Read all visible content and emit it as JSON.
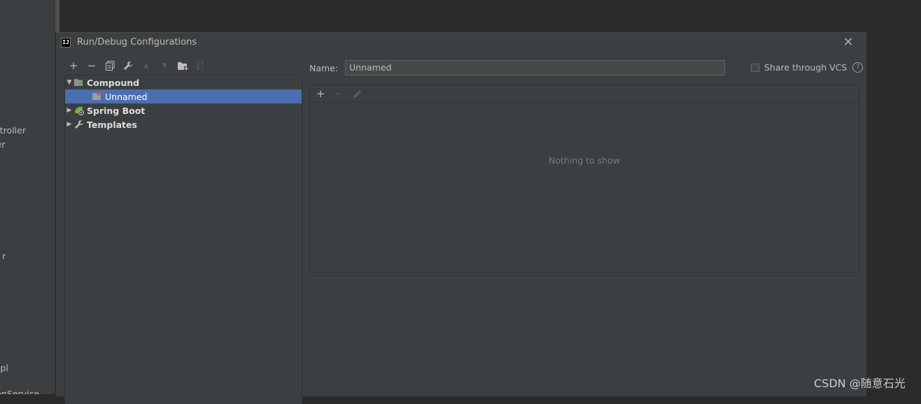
{
  "background_panel": {
    "fragments": [
      "onController",
      "ller",
      "r",
      "er",
      "mpl",
      "ationService"
    ]
  },
  "dialog": {
    "app_icon_text": "IJ",
    "title": "Run/Debug Configurations",
    "close_glyph": "✕"
  },
  "toolbar": {
    "items": [
      {
        "name": "add",
        "glyph": "+",
        "enabled": true
      },
      {
        "name": "remove",
        "glyph": "−",
        "enabled": true
      },
      {
        "name": "copy",
        "glyph": "⧉",
        "enabled": true
      },
      {
        "name": "edit-defaults",
        "glyph": "wrench-icon",
        "enabled": true
      },
      {
        "name": "move-up",
        "glyph": "▲",
        "enabled": false
      },
      {
        "name": "move-down",
        "glyph": "▼",
        "enabled": false
      },
      {
        "name": "new-folder",
        "glyph": "folder-icon",
        "enabled": true
      },
      {
        "name": "sort",
        "glyph": "sort-icon",
        "enabled": false
      }
    ]
  },
  "tree": {
    "items": [
      {
        "label": "Compound",
        "expanded": true,
        "bold": true,
        "icon": "compound-icon"
      },
      {
        "label": "Unnamed",
        "selected": true,
        "icon": "compound-child-icon"
      },
      {
        "label": "Spring Boot",
        "expanded": false,
        "bold": true,
        "icon": "spring-boot-icon"
      },
      {
        "label": "Templates",
        "expanded": false,
        "bold": true,
        "icon": "wrench-icon"
      }
    ]
  },
  "form": {
    "name_label": "Name:",
    "name_value": "Unnamed",
    "share_label": "Share through VCS",
    "share_checked": false,
    "help_glyph": "?"
  },
  "subpanel": {
    "empty_text": "Nothing to show"
  },
  "watermark": "CSDN @随意石光",
  "colors": {
    "selection": "#4b6eaf",
    "background": "#3c3f41",
    "editor_bg": "#2b2b2b"
  }
}
